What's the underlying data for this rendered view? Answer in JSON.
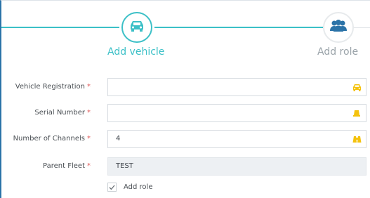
{
  "wizard": {
    "steps": [
      {
        "label": "Add vehicle",
        "icon": "car-icon",
        "state": "active"
      },
      {
        "label": "Add role",
        "icon": "users-icon",
        "state": "inactive"
      }
    ]
  },
  "form": {
    "vehicle_registration": {
      "label": "Vehicle Registration",
      "required_mark": "*",
      "value": "",
      "icon": "car-icon"
    },
    "serial_number": {
      "label": "Serial Number",
      "required_mark": "*",
      "value": "",
      "icon": "bell-icon"
    },
    "number_of_channels": {
      "label": "Number of Channels",
      "required_mark": "*",
      "value": "4",
      "icon": "binoculars-icon"
    },
    "parent_fleet": {
      "label": "Parent Fleet",
      "required_mark": "*",
      "value": "TEST",
      "disabled": true
    },
    "add_role": {
      "label": "Add role",
      "checked": true
    }
  },
  "colors": {
    "accent": "#3cc0c7",
    "icon": "#f4c20d",
    "required": "#e05a5a",
    "inactive": "#9aa3a9",
    "frame": "#2b73a8"
  }
}
